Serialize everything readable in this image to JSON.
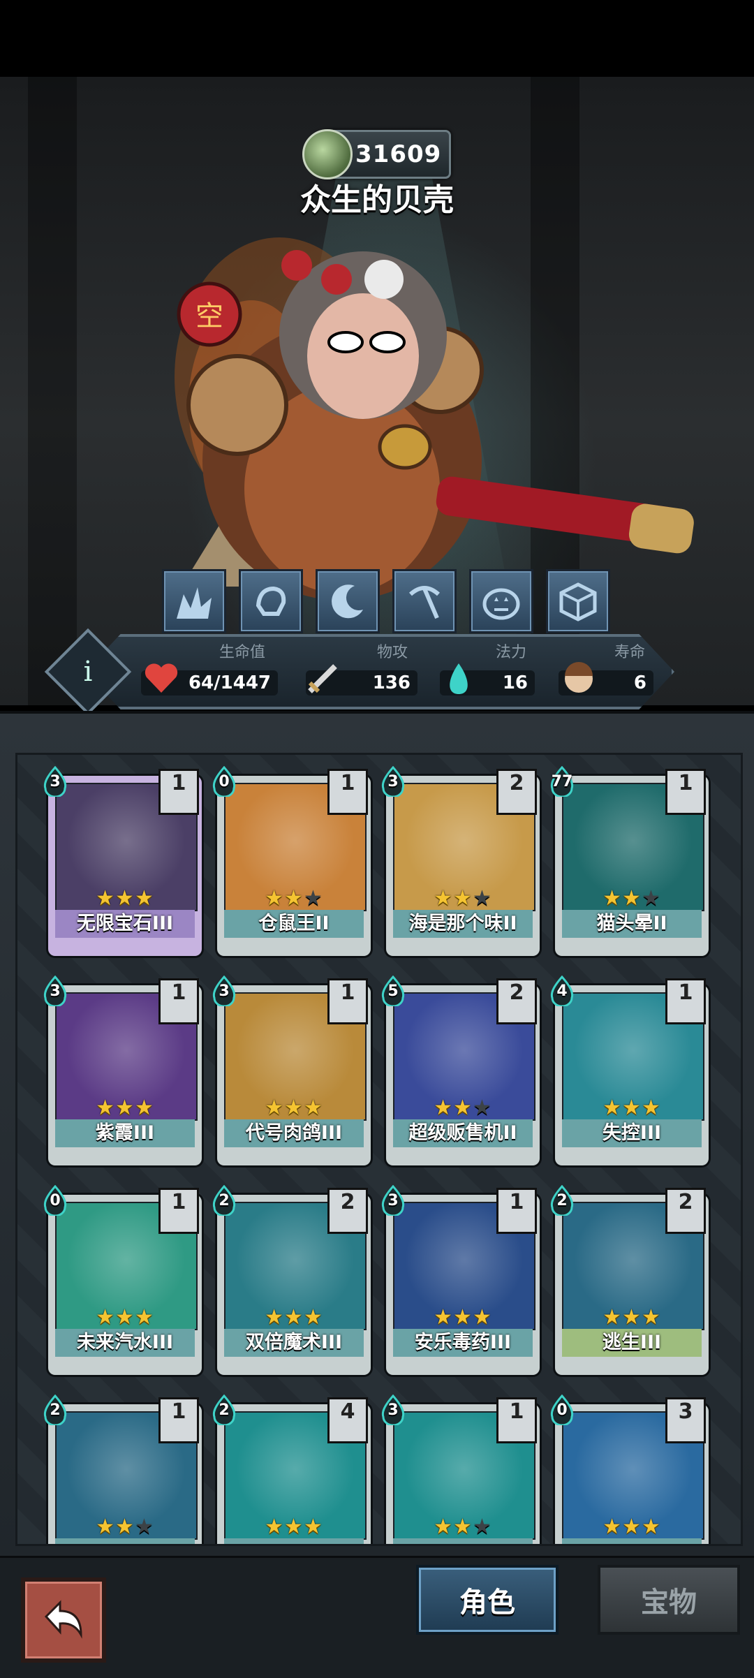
{
  "hero": {
    "gem_value": "31609",
    "name": "众生的贝壳"
  },
  "skills": [
    "burst-icon",
    "fist-icon",
    "moon-icon",
    "pickaxe-icon",
    "pumpkin-icon",
    "cube-icon"
  ],
  "stats": {
    "hp_label": "生命值",
    "hp_value": "64/1447",
    "atk_label": "物攻",
    "atk_value": "136",
    "mana_label": "法力",
    "mana_value": "16",
    "life_label": "寿命",
    "life_value": "6"
  },
  "cards": [
    {
      "name": "无限宝石III",
      "cost": "3",
      "level": "1",
      "stars": 3,
      "theme": "purple",
      "art": "#4b3f66"
    },
    {
      "name": "仓鼠王II",
      "cost": "0",
      "level": "1",
      "stars": 2,
      "theme": "teal",
      "art": "#c9823a"
    },
    {
      "name": "海是那个味II",
      "cost": "3",
      "level": "2",
      "stars": 2,
      "theme": "teal",
      "art": "#c79a4a"
    },
    {
      "name": "猫头晕II",
      "cost": "77",
      "level": "1",
      "stars": 2,
      "theme": "teal",
      "art": "#1f6b6b"
    },
    {
      "name": "紫霞III",
      "cost": "3",
      "level": "1",
      "stars": 3,
      "theme": "teal",
      "art": "#5b3b86"
    },
    {
      "name": "代号肉鸽III",
      "cost": "3",
      "level": "1",
      "stars": 3,
      "theme": "teal",
      "art": "#b98a3a"
    },
    {
      "name": "超级贩售机II",
      "cost": "5",
      "level": "2",
      "stars": 2,
      "theme": "teal",
      "art": "#3a4b9a"
    },
    {
      "name": "失控III",
      "cost": "4",
      "level": "1",
      "stars": 3,
      "theme": "teal",
      "art": "#2a8a96"
    },
    {
      "name": "未来汽水III",
      "cost": "0",
      "level": "1",
      "stars": 3,
      "theme": "teal",
      "art": "#2f9a84"
    },
    {
      "name": "双倍魔术III",
      "cost": "2",
      "level": "2",
      "stars": 3,
      "theme": "teal",
      "art": "#2a7c88"
    },
    {
      "name": "安乐毒药III",
      "cost": "3",
      "level": "1",
      "stars": 3,
      "theme": "teal",
      "art": "#2a4d8a"
    },
    {
      "name": "逃生III",
      "cost": "2",
      "level": "2",
      "stars": 3,
      "theme": "green",
      "art": "#2a6a86"
    },
    {
      "name": "",
      "cost": "2",
      "level": "1",
      "stars": 2,
      "theme": "teal",
      "art": "#2a6a86"
    },
    {
      "name": "",
      "cost": "2",
      "level": "4",
      "stars": 3,
      "theme": "teal",
      "art": "#1f8f8f"
    },
    {
      "name": "",
      "cost": "3",
      "level": "1",
      "stars": 2,
      "theme": "teal",
      "art": "#1f8f8f"
    },
    {
      "name": "",
      "cost": "0",
      "level": "3",
      "stars": 3,
      "theme": "teal",
      "art": "#2a6aa0"
    }
  ],
  "nav": {
    "tab_role": "角色",
    "tab_treasure": "宝物"
  },
  "colors": {
    "star": "#f5c431",
    "accent": "#6aa3a6"
  }
}
